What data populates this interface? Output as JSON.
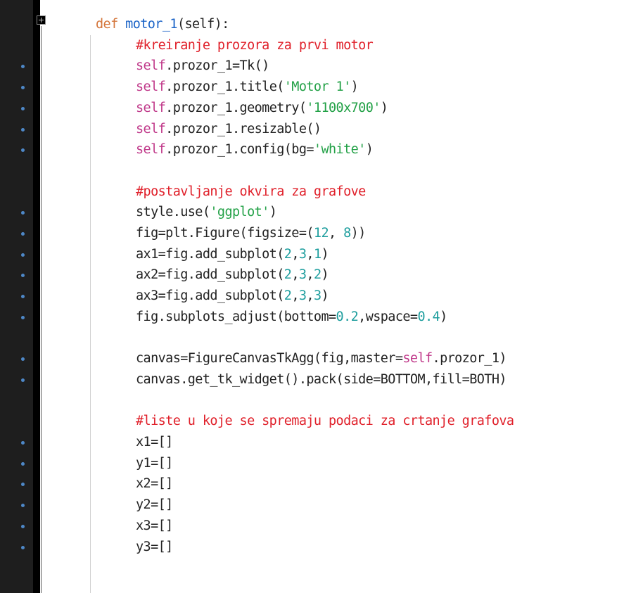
{
  "editor": {
    "language": "python",
    "colors": {
      "gutter_bg": "#1e1e1e",
      "marker": "#4e88c7",
      "comment": "#e0202a",
      "keyword": "#d4753a",
      "function_name": "#1a63c7",
      "self_keyword": "#c0398a",
      "string": "#23a147",
      "number": "#1e9e9e",
      "plain": "#222222"
    },
    "lines": [
      {
        "indent": 1,
        "tokens": [
          {
            "t": "def ",
            "k": "kw"
          },
          {
            "t": "motor_1",
            "k": "fn"
          },
          {
            "t": "(self):",
            "k": "p"
          }
        ]
      },
      {
        "indent": 2,
        "tokens": [
          {
            "t": "#kreiranje prozora za prvi motor",
            "k": "c"
          }
        ]
      },
      {
        "indent": 2,
        "tokens": [
          {
            "t": "self",
            "k": "self"
          },
          {
            "t": ".prozor_1=Tk()",
            "k": "p"
          }
        ]
      },
      {
        "indent": 2,
        "tokens": [
          {
            "t": "self",
            "k": "self"
          },
          {
            "t": ".prozor_1.title(",
            "k": "p"
          },
          {
            "t": "'Motor 1'",
            "k": "s"
          },
          {
            "t": ")",
            "k": "p"
          }
        ]
      },
      {
        "indent": 2,
        "tokens": [
          {
            "t": "self",
            "k": "self"
          },
          {
            "t": ".prozor_1.geometry(",
            "k": "p"
          },
          {
            "t": "'1100x700'",
            "k": "s"
          },
          {
            "t": ")",
            "k": "p"
          }
        ]
      },
      {
        "indent": 2,
        "tokens": [
          {
            "t": "self",
            "k": "self"
          },
          {
            "t": ".prozor_1.resizable()",
            "k": "p"
          }
        ]
      },
      {
        "indent": 2,
        "tokens": [
          {
            "t": "self",
            "k": "self"
          },
          {
            "t": ".prozor_1.config(bg=",
            "k": "p"
          },
          {
            "t": "'white'",
            "k": "s"
          },
          {
            "t": ")",
            "k": "p"
          }
        ]
      },
      {
        "indent": 0,
        "tokens": []
      },
      {
        "indent": 2,
        "tokens": [
          {
            "t": "#postavljanje okvira za grafove",
            "k": "c"
          }
        ]
      },
      {
        "indent": 2,
        "tokens": [
          {
            "t": "style.use(",
            "k": "p"
          },
          {
            "t": "'ggplot'",
            "k": "s"
          },
          {
            "t": ")",
            "k": "p"
          }
        ]
      },
      {
        "indent": 2,
        "tokens": [
          {
            "t": "fig=plt.Figure(figsize=(",
            "k": "p"
          },
          {
            "t": "12",
            "k": "n"
          },
          {
            "t": ", ",
            "k": "p"
          },
          {
            "t": "8",
            "k": "n"
          },
          {
            "t": "))",
            "k": "p"
          }
        ]
      },
      {
        "indent": 2,
        "tokens": [
          {
            "t": "ax1=fig.add_subplot(",
            "k": "p"
          },
          {
            "t": "2",
            "k": "n"
          },
          {
            "t": ",",
            "k": "p"
          },
          {
            "t": "3",
            "k": "n"
          },
          {
            "t": ",",
            "k": "p"
          },
          {
            "t": "1",
            "k": "n"
          },
          {
            "t": ")",
            "k": "p"
          }
        ]
      },
      {
        "indent": 2,
        "tokens": [
          {
            "t": "ax2=fig.add_subplot(",
            "k": "p"
          },
          {
            "t": "2",
            "k": "n"
          },
          {
            "t": ",",
            "k": "p"
          },
          {
            "t": "3",
            "k": "n"
          },
          {
            "t": ",",
            "k": "p"
          },
          {
            "t": "2",
            "k": "n"
          },
          {
            "t": ")",
            "k": "p"
          }
        ]
      },
      {
        "indent": 2,
        "tokens": [
          {
            "t": "ax3=fig.add_subplot(",
            "k": "p"
          },
          {
            "t": "2",
            "k": "n"
          },
          {
            "t": ",",
            "k": "p"
          },
          {
            "t": "3",
            "k": "n"
          },
          {
            "t": ",",
            "k": "p"
          },
          {
            "t": "3",
            "k": "n"
          },
          {
            "t": ")",
            "k": "p"
          }
        ]
      },
      {
        "indent": 2,
        "tokens": [
          {
            "t": "fig.subplots_adjust(bottom=",
            "k": "p"
          },
          {
            "t": "0.2",
            "k": "n"
          },
          {
            "t": ",wspace=",
            "k": "p"
          },
          {
            "t": "0.4",
            "k": "n"
          },
          {
            "t": ")",
            "k": "p"
          }
        ]
      },
      {
        "indent": 0,
        "tokens": []
      },
      {
        "indent": 2,
        "tokens": [
          {
            "t": "canvas=FigureCanvasTkAgg(fig,master=",
            "k": "p"
          },
          {
            "t": "self",
            "k": "self"
          },
          {
            "t": ".prozor_1)",
            "k": "p"
          }
        ]
      },
      {
        "indent": 2,
        "tokens": [
          {
            "t": "canvas.get_tk_widget().pack(side=BOTTOM,fill=BOTH)",
            "k": "p"
          }
        ]
      },
      {
        "indent": 0,
        "tokens": []
      },
      {
        "indent": 2,
        "tokens": [
          {
            "t": "#liste u koje se spremaju podaci za crtanje grafova",
            "k": "c"
          }
        ]
      },
      {
        "indent": 2,
        "tokens": [
          {
            "t": "x1=[]",
            "k": "p"
          }
        ]
      },
      {
        "indent": 2,
        "tokens": [
          {
            "t": "y1=[]",
            "k": "p"
          }
        ]
      },
      {
        "indent": 2,
        "tokens": [
          {
            "t": "x2=[]",
            "k": "p"
          }
        ]
      },
      {
        "indent": 2,
        "tokens": [
          {
            "t": "y2=[]",
            "k": "p"
          }
        ]
      },
      {
        "indent": 2,
        "tokens": [
          {
            "t": "x3=[]",
            "k": "p"
          }
        ]
      },
      {
        "indent": 2,
        "tokens": [
          {
            "t": "y3=[]",
            "k": "p"
          }
        ]
      }
    ],
    "markers_on_lines": [
      2,
      3,
      4,
      5,
      6,
      9,
      10,
      11,
      12,
      13,
      14,
      16,
      17,
      20,
      21,
      22,
      23,
      24,
      25
    ]
  }
}
